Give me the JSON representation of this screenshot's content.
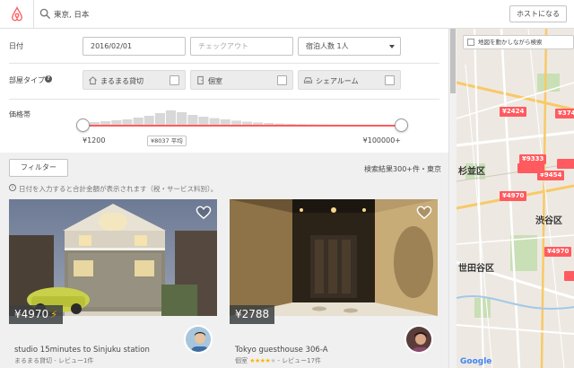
{
  "header": {
    "search_value": "東京, 日本",
    "host_button": "ホストになる"
  },
  "filters": {
    "date_label": "日付",
    "checkin_value": "2016/02/01",
    "checkout_placeholder": "チェックアウト",
    "guests_value": "宿泊人数 1人",
    "room_type_label": "部屋タイプ",
    "room_types": [
      {
        "label": "まるまる貸切",
        "icon": "house-icon"
      },
      {
        "label": "個室",
        "icon": "door-icon"
      },
      {
        "label": "シェアルーム",
        "icon": "sofa-icon"
      }
    ],
    "price_label": "価格帯",
    "price_min": "¥1200",
    "price_avg": "¥8037 平均",
    "price_max": "¥100000+",
    "histogram_levels": [
      0.2,
      0.25,
      0.3,
      0.35,
      0.45,
      0.55,
      0.7,
      0.85,
      0.75,
      0.6,
      0.5,
      0.42,
      0.35,
      0.28,
      0.22,
      0.18,
      0.15,
      0.12,
      0.1,
      0.08,
      0.07,
      0.06,
      0.06,
      0.05,
      0.05,
      0.04,
      0.04,
      0.04
    ]
  },
  "results": {
    "filter_button": "フィルター",
    "count_text": "検索結果300+件・東京",
    "info_text": "日付を入力すると合計金額が表示されます（税・サービス料別）。"
  },
  "listings": [
    {
      "price": "¥4970",
      "instant_book": true,
      "title": "studio 15minutes to Sinjuku station",
      "meta": "まるまる貸切 - レビュー1件",
      "stars": 0
    },
    {
      "price": "¥2788",
      "instant_book": false,
      "title": "Tokyo guesthouse 306-A",
      "meta_type": "個室",
      "meta_reviews": "- レビュー17件",
      "stars": 4
    }
  ],
  "map": {
    "checkbox_label": "地図を動かしながら検索",
    "prices": [
      "¥2424",
      "¥374",
      "¥9333",
      "¥9454",
      "¥4970",
      "¥4970"
    ],
    "districts": [
      "杉並区",
      "渋谷区",
      "世田谷区"
    ],
    "attribution": "Google"
  },
  "colors": {
    "brand": "#ff5a5f",
    "text": "#484848",
    "star": "#ffb400"
  }
}
